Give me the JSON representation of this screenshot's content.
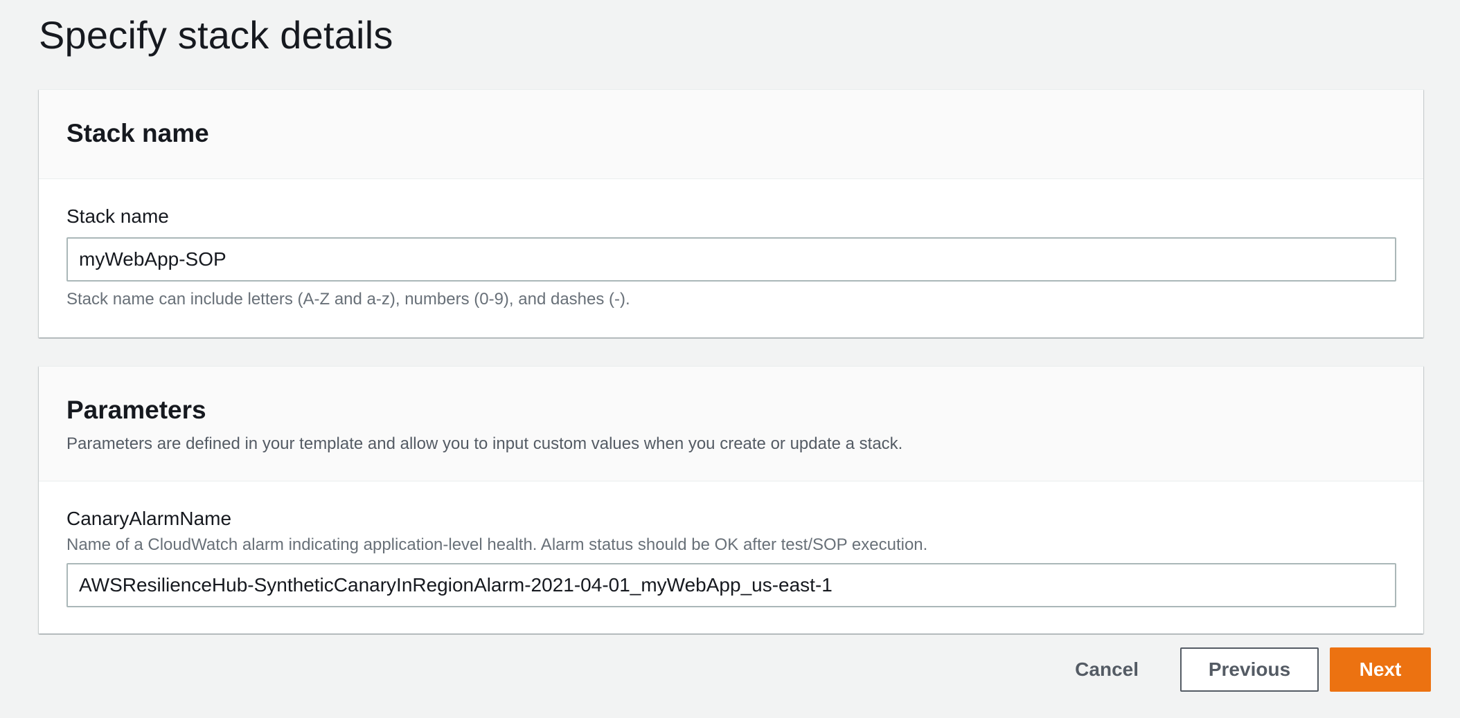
{
  "page": {
    "title": "Specify stack details"
  },
  "stack_panel": {
    "title": "Stack name",
    "field_label": "Stack name",
    "field_value": "myWebApp-SOP",
    "constraint": "Stack name can include letters (A-Z and a-z), numbers (0-9), and dashes (-)."
  },
  "parameters_panel": {
    "title": "Parameters",
    "description": "Parameters are defined in your template and allow you to input custom values when you create or update a stack.",
    "params": [
      {
        "name": "CanaryAlarmName",
        "description": "Name of a CloudWatch alarm indicating application-level health. Alarm status should be OK after test/SOP execution.",
        "value": "AWSResilienceHub-SyntheticCanaryInRegionAlarm-2021-04-01_myWebApp_us-east-1"
      }
    ]
  },
  "actions": {
    "cancel_label": "Cancel",
    "previous_label": "Previous",
    "next_label": "Next"
  },
  "colors": {
    "background": "#f2f3f3",
    "primary_button": "#ec7211",
    "text_dark": "#16191f",
    "text_muted": "#687078"
  }
}
